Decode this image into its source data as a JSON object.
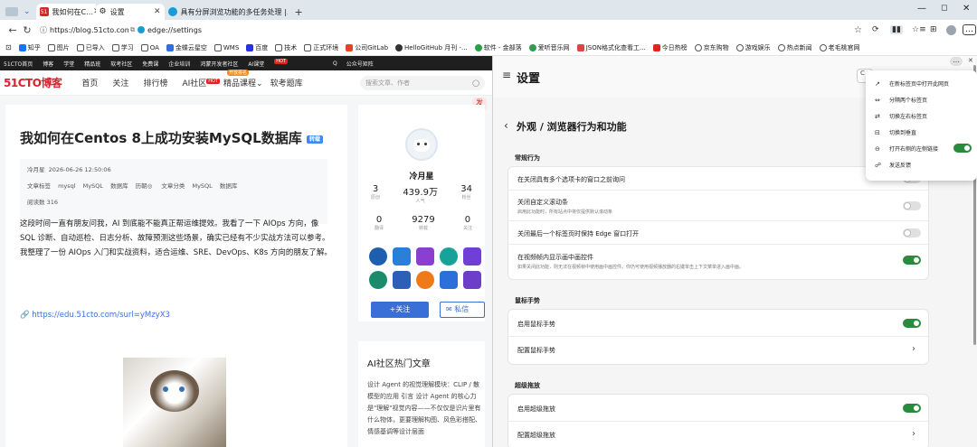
{
  "tabs": [
    {
      "title": "我如何在C…",
      "favicon": "51"
    },
    {
      "title": "设置",
      "favicon": "gear-icon"
    },
    {
      "title": "具有分屏浏览功能的多任务处理 |…",
      "favicon": "edge-icon"
    }
  ],
  "tabbar": {
    "new_tab": "+",
    "minimize": "—",
    "maximize": "◯"
  },
  "address": {
    "left_url": "https://blog.51cto.com",
    "right_url": "edge://settings",
    "edge_label": "Edge"
  },
  "bookmarks": [
    "知乎",
    "图片",
    "已导入",
    "学习",
    "OA",
    "金蝶云星空",
    "WMS",
    "百度",
    "技术",
    "正式环境",
    "公司GitLab",
    "HelloGitHub 月刊 -...",
    "软件 - 金部落",
    "爱听音乐网",
    "JSON格式化查看工...",
    "今日热榜",
    "京东购物",
    "游戏娱乐",
    "热点新闻",
    "老毛桃官网"
  ],
  "site": {
    "topnav": [
      "51CTO首页",
      "博客",
      "学堂",
      "精品班",
      "软考社区",
      "免费课",
      "企业培训",
      "鸿蒙开发者社区",
      "AI课堂",
      "公众号矩阵"
    ],
    "topnav_hot": "HOT",
    "logo": "51CTO博客",
    "mainnav": [
      "首页",
      "关注",
      "排行榜",
      "AI社区",
      "精品课程",
      "软考题库"
    ],
    "ai_hot": "HOT",
    "course_badge": "开放报名",
    "search_placeholder": "搜索文章、作者",
    "publish": "发",
    "article": {
      "title": "我如何在Centos 8上成功安装MySQL数据库",
      "badge": "转载",
      "author": "冷月星",
      "date": "2026-06-26 12:50:06",
      "tags_label": "文章标签",
      "tags": [
        "mysql",
        "MySQL",
        "数据库",
        "历朝◎"
      ],
      "category_label": "文章分类",
      "categories": [
        "MySQL",
        "数据库"
      ],
      "reads_label": "阅读数",
      "reads": "316",
      "body": "这段时间一直有朋友问我，AI 到底能不能真正帮运维提效。我看了一下 AIOps 方向，像 SQL 诊断、自动巡检、日志分析、故障预测这些场景，确实已经有不少实战方法可以参考。我整理了一份 AIOps 入门和实战资料，适合运维、SRE、DevOps、K8s 方向的朋友了解。",
      "link": "https://edu.51cto.com/surl=yMzyX3"
    },
    "profile": {
      "name": "冷月星",
      "stats1": [
        {
          "v": "3",
          "l": "原创"
        },
        {
          "v": "439.9万",
          "l": "人气"
        },
        {
          "v": "34",
          "l": "粉丝"
        }
      ],
      "stats2": [
        {
          "v": "0",
          "l": "翻译"
        },
        {
          "v": "9279",
          "l": "转载"
        },
        {
          "v": "0",
          "l": "关注"
        }
      ],
      "follow": "+关注",
      "message": "私信"
    },
    "hot": {
      "title": "AI社区热门文章",
      "text": "设计 Agent 的视觉理解模块：CLIP / 散模型的应用 引言 设计 Agent 的核心力是\"理解\"视觉内容——不仅仅是识片里有什么物体，更要理解构图、风色彩搭配、情感基调等设计层面"
    }
  },
  "settings": {
    "header": "设置",
    "search_placeholder": "C",
    "breadcrumb": "外观 / 浏览器行为和功能",
    "back": "‹",
    "sections": [
      {
        "title": "常规行为",
        "rows": [
          {
            "label": "在关闭具有多个选项卡的窗口之前询问",
            "desc": "",
            "state": "off"
          },
          {
            "label": "关闭自定义滚动条",
            "desc": "启用此功能时，所有站点中将仅提供默认滚动条",
            "state": "off"
          },
          {
            "label": "关闭最后一个标签页时保持 Edge 窗口打开",
            "desc": "",
            "state": "off"
          },
          {
            "label": "在视频帧内显示画中画控件",
            "desc": "如果关闭此功能，则无法在视频帧中使用画中画控件。你仍可使用视频播放器的右键单击上下文菜单进入画中画。",
            "state": "on"
          }
        ]
      },
      {
        "title": "鼠标手势",
        "rows": [
          {
            "label": "启用鼠标手势",
            "desc": "",
            "state": "on"
          },
          {
            "label": "配置鼠标手势",
            "desc": "",
            "state": "arrow"
          }
        ]
      },
      {
        "title": "超级拖放",
        "rows": [
          {
            "label": "启用超级拖放",
            "desc": "",
            "state": "on"
          },
          {
            "label": "配置超级拖放",
            "desc": "",
            "state": "arrow"
          }
        ]
      }
    ]
  },
  "menu": {
    "items": [
      {
        "icon": "open-new-tab-icon",
        "glyph": "↗",
        "label": "在新标签页中打开此网页"
      },
      {
        "icon": "split-icon",
        "glyph": "⇔",
        "label": "分隔两个标签页"
      },
      {
        "icon": "swap-icon",
        "glyph": "⇄",
        "label": "切换左右标签页"
      },
      {
        "icon": "vertical-icon",
        "glyph": "⊟",
        "label": "切换到垂直"
      },
      {
        "icon": "link-icon",
        "glyph": "⊖",
        "label": "打开右侧的左侧链接"
      },
      {
        "icon": "feedback-icon",
        "glyph": "☍",
        "label": "发送反馈"
      }
    ],
    "link_toggle": "on"
  }
}
